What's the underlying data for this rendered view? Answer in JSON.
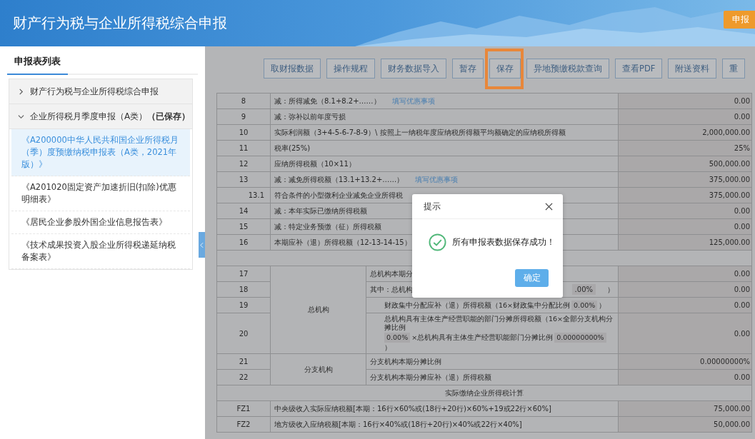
{
  "header": {
    "title": "财产行为税与企业所得税综合申报",
    "action": "申报"
  },
  "sidebar": {
    "tab": "申报表列表",
    "groups": [
      {
        "title": "财产行为税与企业所得税综合申报",
        "expanded": false
      },
      {
        "title": "企业所得税月季度申报（A类）**（已保存）**",
        "expanded": true,
        "items": [
          {
            "label": "《A200000中华人民共和国企业所得税月（季）度预缴纳税申报表（A类，2021年版）》",
            "selected": true
          },
          {
            "label": "《A201020固定资产加速折旧(扣除)优惠明细表》",
            "selected": false
          },
          {
            "label": "《居民企业参股外国企业信息报告表》",
            "selected": false
          },
          {
            "label": "《技术成果投资入股企业所得税递延纳税备案表》",
            "selected": false
          }
        ]
      }
    ]
  },
  "toolbar": [
    {
      "label": "取财报数据",
      "highlighted": false
    },
    {
      "label": "操作规程",
      "highlighted": false
    },
    {
      "label": "财务数据导入",
      "highlighted": false
    },
    {
      "label": "暂存",
      "highlighted": false
    },
    {
      "label": "保存",
      "highlighted": true
    },
    {
      "label": "异地预缴税款查询",
      "highlighted": false
    },
    {
      "label": "查看PDF",
      "highlighted": false
    },
    {
      "label": "附送资料",
      "highlighted": false
    },
    {
      "label": "重",
      "highlighted": false
    }
  ],
  "table": {
    "rows": [
      {
        "kind": "line",
        "number": "8",
        "parts": [
          {
            "kind": "text",
            "text": "减：所得减免（8.1+8.2+……）"
          },
          {
            "kind": "link",
            "text": "填写优惠事项"
          }
        ],
        "value": "0.00"
      },
      {
        "kind": "line",
        "number": "9",
        "parts": [
          {
            "kind": "text",
            "text": "减：弥补以前年度亏损"
          }
        ],
        "value": "0.00"
      },
      {
        "kind": "line",
        "number": "10",
        "parts": [
          {
            "kind": "text",
            "text": "实际利润额（3+4-5-6-7-8-9）\\ 按照上一纳税年度应纳税所得额平均额确定的应纳税所得额"
          }
        ],
        "value": "2,000,000.00"
      },
      {
        "kind": "line",
        "number": "11",
        "parts": [
          {
            "kind": "text",
            "text": "税率(25%)"
          }
        ],
        "value": "25%"
      },
      {
        "kind": "line",
        "number": "12",
        "parts": [
          {
            "kind": "text",
            "text": "应纳所得税额（10×11）"
          }
        ],
        "value": "500,000.00"
      },
      {
        "kind": "line",
        "number": "13",
        "parts": [
          {
            "kind": "text",
            "text": "减：减免所得税额（13.1+13.2+……）"
          },
          {
            "kind": "link",
            "text": "填写优惠事项"
          }
        ],
        "value": "375,000.00"
      },
      {
        "kind": "subline",
        "number": "13.1",
        "parts": [
          {
            "kind": "text",
            "text": "符合条件的小型微利企业减免企业所得税"
          }
        ],
        "value": "375,000.00"
      },
      {
        "kind": "line",
        "number": "14",
        "parts": [
          {
            "kind": "text",
            "text": "减：本年实际已缴纳所得税额"
          }
        ],
        "value": "0.00"
      },
      {
        "kind": "line",
        "number": "15",
        "parts": [
          {
            "kind": "text",
            "text": "减：特定业务预缴（征）所得税额"
          }
        ],
        "value": "0.00"
      },
      {
        "kind": "line",
        "number": "16",
        "parts": [
          {
            "kind": "text",
            "text": "本期应补（退）所得税额（12-13-14-15）"
          }
        ],
        "value": "125,000.00"
      }
    ],
    "groups": [
      {
        "name": "总机构",
        "rows": [
          {
            "number": "17",
            "indented": false,
            "parts": [
              {
                "kind": "text",
                "text": "总机构本期分"
              }
            ],
            "value": "0.00"
          },
          {
            "number": "18",
            "indented": false,
            "parts": [
              {
                "kind": "text",
                "text": "其中：总机构"
              },
              {
                "kind": "gap"
              },
              {
                "kind": "box",
                "text": ".00%"
              },
              {
                "kind": "text",
                "text": "）"
              }
            ],
            "value": "0.00"
          },
          {
            "number": "19",
            "indented": true,
            "parts": [
              {
                "kind": "text",
                "text": "财政集中分配应补（退）所得税额（16×财政集中分配比例"
              },
              {
                "kind": "box",
                "text": "0.00%"
              },
              {
                "kind": "text",
                "text": "）"
              }
            ],
            "value": "0.00"
          },
          {
            "number": "20",
            "indented": true,
            "parts": [
              {
                "kind": "text",
                "text": "总机构具有主体生产经营职能的部门分摊所得税额（16×全部分支机构分摊比例"
              },
              {
                "kind": "box",
                "text": "0.00%"
              },
              {
                "kind": "text",
                "text": "×总机构具有主体生产经营职能部门分摊比例"
              },
              {
                "kind": "box",
                "text": "0.00000000%"
              },
              {
                "kind": "text",
                "text": "）"
              }
            ],
            "value": "0.00"
          }
        ]
      },
      {
        "name": "分支机构",
        "rows": [
          {
            "number": "21",
            "indented": false,
            "parts": [
              {
                "kind": "text",
                "text": "分支机构本期分摊比例"
              }
            ],
            "value": "0.00000000%"
          },
          {
            "number": "22",
            "indented": false,
            "parts": [
              {
                "kind": "text",
                "text": "分支机构本期分摊应补（退）所得税额"
              }
            ],
            "value": "0.00"
          }
        ]
      }
    ],
    "section_title": "实际缴纳企业所得税计算",
    "bottom_rows": [
      {
        "number": "FZ1",
        "parts": [
          {
            "kind": "text",
            "text": "中央级收入实际应纳税额[本期：16行×60%或(18行+20行)×60%+19或22行×60%]"
          }
        ],
        "value": "75,000.00"
      },
      {
        "number": "FZ2",
        "parts": [
          {
            "kind": "text",
            "text": "地方级收入应纳税额[本期：16行×40%或(18行+20行)×40%或22行×40%]"
          }
        ],
        "value": "50,000.00"
      }
    ]
  },
  "dialog": {
    "title": "提示",
    "message": "所有申报表数据保存成功！",
    "button": "确定"
  }
}
